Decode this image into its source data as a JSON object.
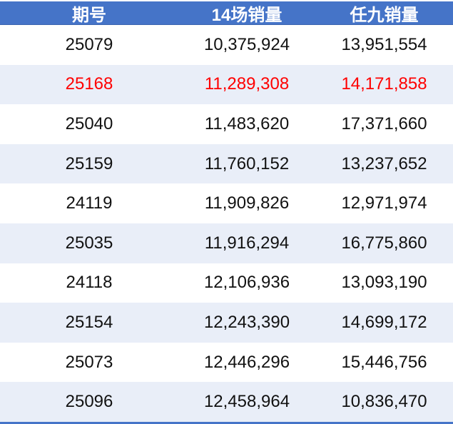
{
  "table": {
    "colors": {
      "accent": "#4574C8",
      "stripe": "#E9EEF8",
      "highlight": "#FF0000",
      "header-text": "#FFFFFF",
      "body-text": "#111111"
    },
    "header": {
      "period": "期号",
      "sales14": "14场销量",
      "ren9": "任九销量"
    },
    "highlighted_row_index": 1,
    "rows": [
      {
        "period": "25079",
        "sales14": "10,375,924",
        "ren9": "13,951,554"
      },
      {
        "period": "25168",
        "sales14": "11,289,308",
        "ren9": "14,171,858"
      },
      {
        "period": "25040",
        "sales14": "11,483,620",
        "ren9": "17,371,660"
      },
      {
        "period": "25159",
        "sales14": "11,760,152",
        "ren9": "13,237,652"
      },
      {
        "period": "24119",
        "sales14": "11,909,826",
        "ren9": "12,971,974"
      },
      {
        "period": "25035",
        "sales14": "11,916,294",
        "ren9": "16,775,860"
      },
      {
        "period": "24118",
        "sales14": "12,106,936",
        "ren9": "13,093,190"
      },
      {
        "period": "25154",
        "sales14": "12,243,390",
        "ren9": "14,699,172"
      },
      {
        "period": "25073",
        "sales14": "12,446,296",
        "ren9": "15,446,756"
      },
      {
        "period": "25096",
        "sales14": "12,458,964",
        "ren9": "10,836,470"
      }
    ]
  },
  "chart_data": {
    "type": "table",
    "columns": [
      "期号",
      "14场销量",
      "任九销量"
    ],
    "rows": [
      [
        "25079",
        "10,375,924",
        "13,951,554"
      ],
      [
        "25168",
        "11,289,308",
        "14,171,858"
      ],
      [
        "25040",
        "11,483,620",
        "17,371,660"
      ],
      [
        "25159",
        "11,760,152",
        "13,237,652"
      ],
      [
        "24119",
        "11,909,826",
        "12,971,974"
      ],
      [
        "25035",
        "11,916,294",
        "16,775,860"
      ],
      [
        "24118",
        "12,106,936",
        "13,093,190"
      ],
      [
        "25154",
        "12,243,390",
        "14,699,172"
      ],
      [
        "25073",
        "12,446,296",
        "15,446,756"
      ],
      [
        "25096",
        "12,458,964",
        "10,836,470"
      ]
    ],
    "highlighted_row": "25168",
    "highlight_color": "#FF0000",
    "layout": {
      "stripe_rows": "even",
      "header_background": "#4574C8"
    }
  }
}
